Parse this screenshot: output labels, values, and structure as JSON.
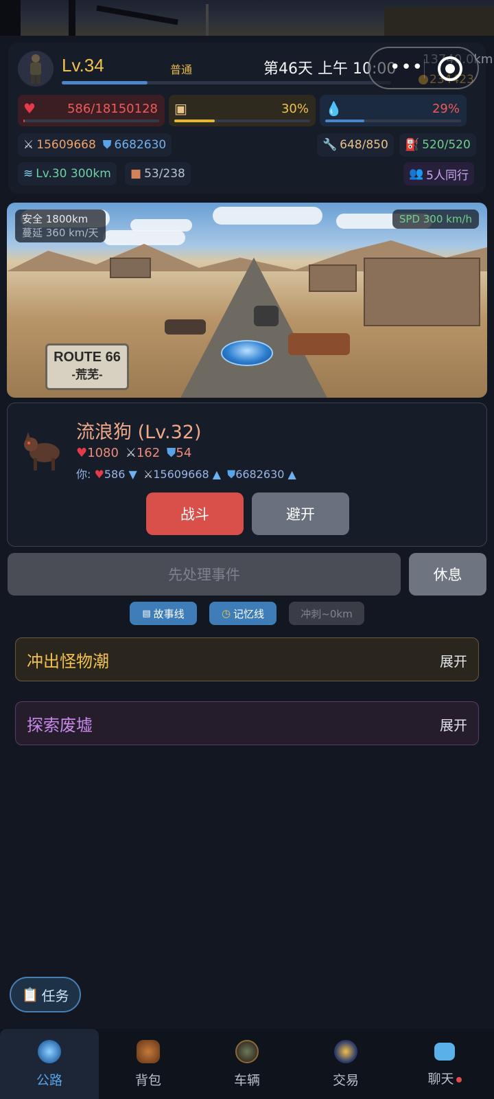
{
  "header": {
    "level": "Lv.34",
    "mode": "普通",
    "day_time": "第46天 上午 10:00",
    "distance": "13740.0km",
    "coins": "234423"
  },
  "stats": {
    "hp": "586/18150128",
    "hp_fraction": 3e-05,
    "food": "30%",
    "food_fraction": 0.3,
    "water": "29%",
    "water_fraction": 0.29,
    "attack": "15609668",
    "defense": "6682630",
    "durability": "648/850",
    "fuel": "520/520",
    "engine": "Lv.30 300km",
    "cargo": "53/238",
    "companions": "5人同行"
  },
  "scene": {
    "safe": "安全 1800km",
    "spread": "蔓延 360 km/天",
    "speed": "SPD 300 km/h",
    "sign_line1": "ROUTE 66",
    "sign_line2": "-荒芜-"
  },
  "encounter": {
    "name": "流浪狗 (Lv.32)",
    "enemy_hp": "1080",
    "enemy_atk": "162",
    "enemy_def": "54",
    "you_label": "你:",
    "you_hp": "586",
    "you_hp_arrow": "▼",
    "you_atk": "15609668",
    "you_atk_arrow": "▲",
    "you_def": "6682630",
    "you_def_arrow": "▲",
    "fight": "战斗",
    "avoid": "避开"
  },
  "actions": {
    "handle_event": "先处理事件",
    "rest": "休息",
    "story": "故事线",
    "memory": "记忆线",
    "sprint": "冲刺~0km"
  },
  "sections": [
    {
      "title": "冲出怪物潮",
      "toggle": "展开"
    },
    {
      "title": "探索废墟",
      "toggle": "展开"
    }
  ],
  "task_button": "任务",
  "tabs": [
    {
      "label": "公路"
    },
    {
      "label": "背包"
    },
    {
      "label": "车辆"
    },
    {
      "label": "交易"
    },
    {
      "label": "聊天"
    }
  ],
  "colors": {
    "accent": "#5aa3e6",
    "danger": "#d9504a",
    "gold": "#f2c14e"
  }
}
